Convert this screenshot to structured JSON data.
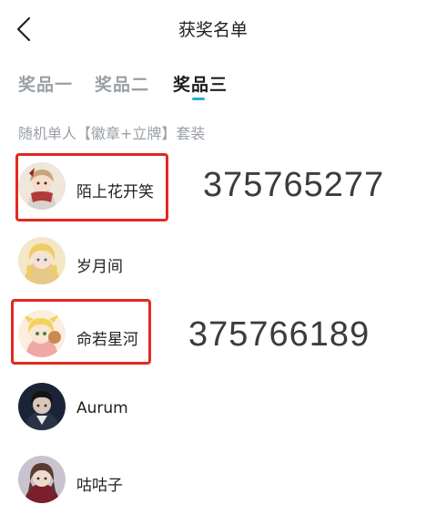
{
  "header": {
    "title": "获奖名单",
    "back_icon": "chevron-left-icon"
  },
  "tabs": [
    {
      "label": "奖品一",
      "active": false
    },
    {
      "label": "奖品二",
      "active": false
    },
    {
      "label": "奖品三",
      "active": true
    }
  ],
  "prize": {
    "description": "随机单人【徽章+立牌】套装"
  },
  "winners": [
    {
      "name": "陌上花开笑",
      "highlighted": true
    },
    {
      "name": "岁月间",
      "highlighted": false
    },
    {
      "name": "命若星河",
      "highlighted": true
    },
    {
      "name": "Aurum",
      "highlighted": false
    },
    {
      "name": "咕咕子",
      "highlighted": false
    }
  ],
  "annotations": [
    {
      "text": "375765277"
    },
    {
      "text": "375766189"
    }
  ],
  "colors": {
    "accent": "#1fb3c9",
    "highlight_box": "#e02a20",
    "inactive_tab": "#9aa0a6"
  }
}
